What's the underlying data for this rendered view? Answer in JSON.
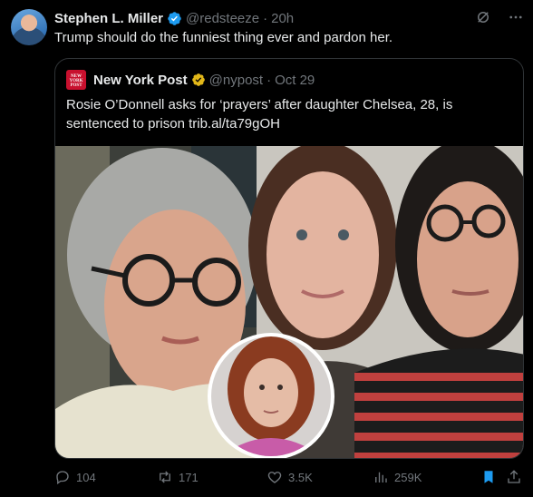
{
  "tweet": {
    "author_name": "Stephen L. Miller",
    "author_handle": "@redsteeze",
    "separator": "·",
    "time": "20h",
    "text": "Trump should do the funniest thing ever and pardon her."
  },
  "quote": {
    "logo_text": "NEW YORK POST",
    "author_name": "New York Post",
    "author_handle": "@nypost",
    "separator": "·",
    "time": "Oct 29",
    "text": "Rosie O’Donnell asks for ‘prayers’ after daughter Chelsea, 28, is sentenced to prison trib.al/ta79gOH"
  },
  "actions": {
    "replies": "104",
    "reposts": "171",
    "likes": "3.5K",
    "views": "259K"
  },
  "icons": {
    "verified": "verified-badge-icon",
    "gold_verified": "gold-verified-badge-icon",
    "grok": "grok-icon",
    "more": "more-icon",
    "reply": "reply-icon",
    "repost": "repost-icon",
    "like": "like-icon",
    "views": "views-icon",
    "bookmark": "bookmark-icon",
    "share": "share-icon"
  },
  "colors": {
    "background": "#000000",
    "text": "#e7e9ea",
    "muted": "#71767b",
    "verified_blue": "#1d9bf0",
    "gold": "#e2b719",
    "nypost_red": "#c8102e"
  }
}
